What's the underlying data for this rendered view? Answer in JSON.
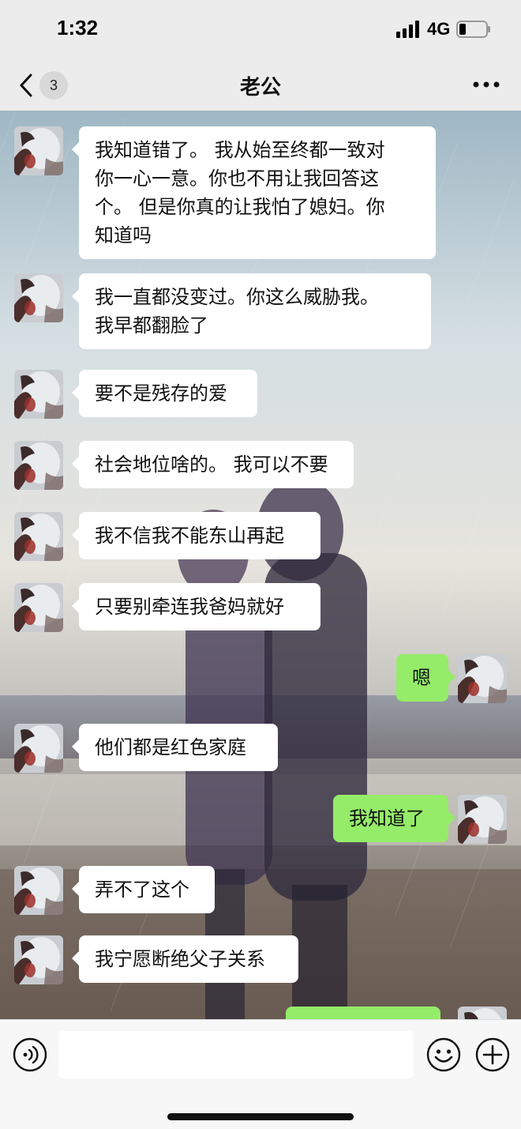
{
  "status_bar": {
    "time": "1:32",
    "network": "4G",
    "signal_icon": "signal-bars-icon",
    "battery_icon": "battery-low-icon"
  },
  "nav": {
    "back_icon": "chevron-left-icon",
    "unread_count": "3",
    "title": "老公",
    "more_icon": "more-dots-icon"
  },
  "colors": {
    "incoming_bubble": "#ffffff",
    "outgoing_bubble": "#95ec69",
    "bar_background": "#ececec"
  },
  "messages": [
    {
      "sender": "other",
      "lines": [
        "我知道错了。 我从始至终都一致对",
        "你一心一意。你也不用让我回答这",
        "个。 但是你真的让我怕了媳妇。你",
        "知道吗"
      ]
    },
    {
      "sender": "other",
      "lines": [
        "我一直都没变过。你这么威胁我。",
        "我早都翻脸了"
      ]
    },
    {
      "sender": "other",
      "lines": [
        "要不是残存的爱"
      ]
    },
    {
      "sender": "other",
      "lines": [
        "社会地位啥的。 我可以不要"
      ]
    },
    {
      "sender": "other",
      "lines": [
        "我不信我不能东山再起"
      ]
    },
    {
      "sender": "other",
      "lines": [
        "只要别牵连我爸妈就好"
      ]
    },
    {
      "sender": "me",
      "lines": [
        "嗯"
      ]
    },
    {
      "sender": "other",
      "lines": [
        "他们都是红色家庭"
      ]
    },
    {
      "sender": "me",
      "lines": [
        "我知道了"
      ]
    },
    {
      "sender": "other",
      "lines": [
        "弄不了这个"
      ]
    },
    {
      "sender": "other",
      "lines": [
        "我宁愿断绝父子关系"
      ]
    }
  ],
  "input_bar": {
    "voice_icon": "voice-icon",
    "text_value": "",
    "emoji_icon": "emoji-icon",
    "plus_icon": "plus-icon"
  }
}
